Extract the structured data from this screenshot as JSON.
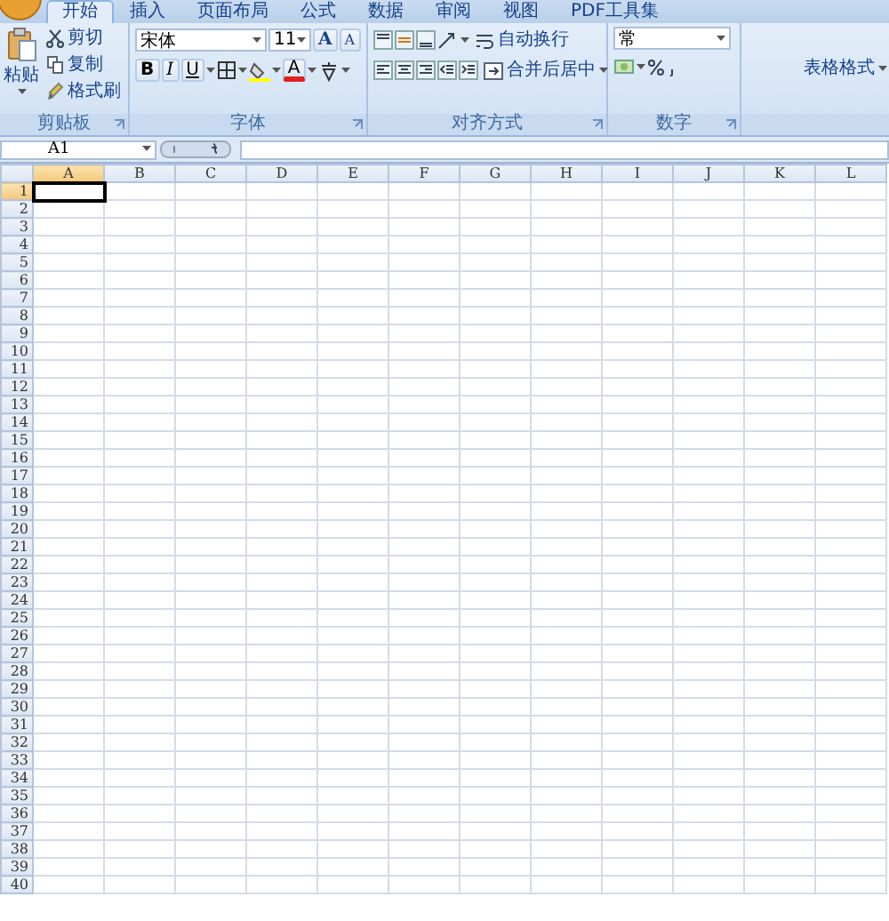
{
  "tabs": [
    {
      "label": "开始",
      "selected": true
    },
    {
      "label": "插入",
      "selected": false
    },
    {
      "label": "页面布局",
      "selected": false
    },
    {
      "label": "公式",
      "selected": false
    },
    {
      "label": "数据",
      "selected": false
    },
    {
      "label": "审阅",
      "selected": false
    },
    {
      "label": "视图",
      "selected": false
    },
    {
      "label": "PDF工具集",
      "selected": false
    }
  ],
  "clipboard": {
    "paste": "粘贴",
    "cut": "剪切",
    "copy": "复制",
    "format_painter": "格式刷",
    "group": "剪贴板"
  },
  "font": {
    "name": "宋体",
    "size": "11",
    "grow": "A",
    "shrink": "A",
    "bold": "B",
    "italic": "I",
    "underline": "U",
    "font_color": "A",
    "group": "字体"
  },
  "alignment": {
    "wrap": "自动换行",
    "merge": "合并后居中",
    "group": "对齐方式"
  },
  "number": {
    "format": "常",
    "group": "数字"
  },
  "styles": {
    "table_format": "表格格式"
  },
  "name_box": "A1",
  "columns": [
    {
      "label": "A",
      "selected": true
    },
    {
      "label": "B",
      "selected": false
    },
    {
      "label": "C",
      "selected": false
    },
    {
      "label": "D",
      "selected": false
    },
    {
      "label": "E",
      "selected": false
    },
    {
      "label": "F",
      "selected": false
    },
    {
      "label": "G",
      "selected": false
    },
    {
      "label": "H",
      "selected": false
    },
    {
      "label": "I",
      "selected": false
    },
    {
      "label": "J",
      "selected": false
    },
    {
      "label": "K",
      "selected": false
    },
    {
      "label": "L",
      "selected": false
    }
  ],
  "rows": [
    {
      "label": "1",
      "selected": true
    },
    {
      "label": "2",
      "selected": false
    },
    {
      "label": "3",
      "selected": false
    },
    {
      "label": "4",
      "selected": false
    },
    {
      "label": "5",
      "selected": false
    },
    {
      "label": "6",
      "selected": false
    },
    {
      "label": "7",
      "selected": false
    },
    {
      "label": "8",
      "selected": false
    },
    {
      "label": "9",
      "selected": false
    },
    {
      "label": "10",
      "selected": false
    },
    {
      "label": "11",
      "selected": false
    },
    {
      "label": "12",
      "selected": false
    },
    {
      "label": "13",
      "selected": false
    },
    {
      "label": "14",
      "selected": false
    },
    {
      "label": "15",
      "selected": false
    },
    {
      "label": "16",
      "selected": false
    },
    {
      "label": "17",
      "selected": false
    },
    {
      "label": "18",
      "selected": false
    },
    {
      "label": "19",
      "selected": false
    },
    {
      "label": "20",
      "selected": false
    },
    {
      "label": "21",
      "selected": false
    },
    {
      "label": "22",
      "selected": false
    },
    {
      "label": "23",
      "selected": false
    },
    {
      "label": "24",
      "selected": false
    },
    {
      "label": "25",
      "selected": false
    },
    {
      "label": "26",
      "selected": false
    },
    {
      "label": "27",
      "selected": false
    },
    {
      "label": "28",
      "selected": false
    },
    {
      "label": "29",
      "selected": false
    },
    {
      "label": "30",
      "selected": false
    },
    {
      "label": "31",
      "selected": false
    },
    {
      "label": "32",
      "selected": false
    },
    {
      "label": "33",
      "selected": false
    },
    {
      "label": "34",
      "selected": false
    },
    {
      "label": "35",
      "selected": false
    },
    {
      "label": "36",
      "selected": false
    },
    {
      "label": "37",
      "selected": false
    },
    {
      "label": "38",
      "selected": false
    },
    {
      "label": "39",
      "selected": false
    },
    {
      "label": "40",
      "selected": false
    }
  ]
}
